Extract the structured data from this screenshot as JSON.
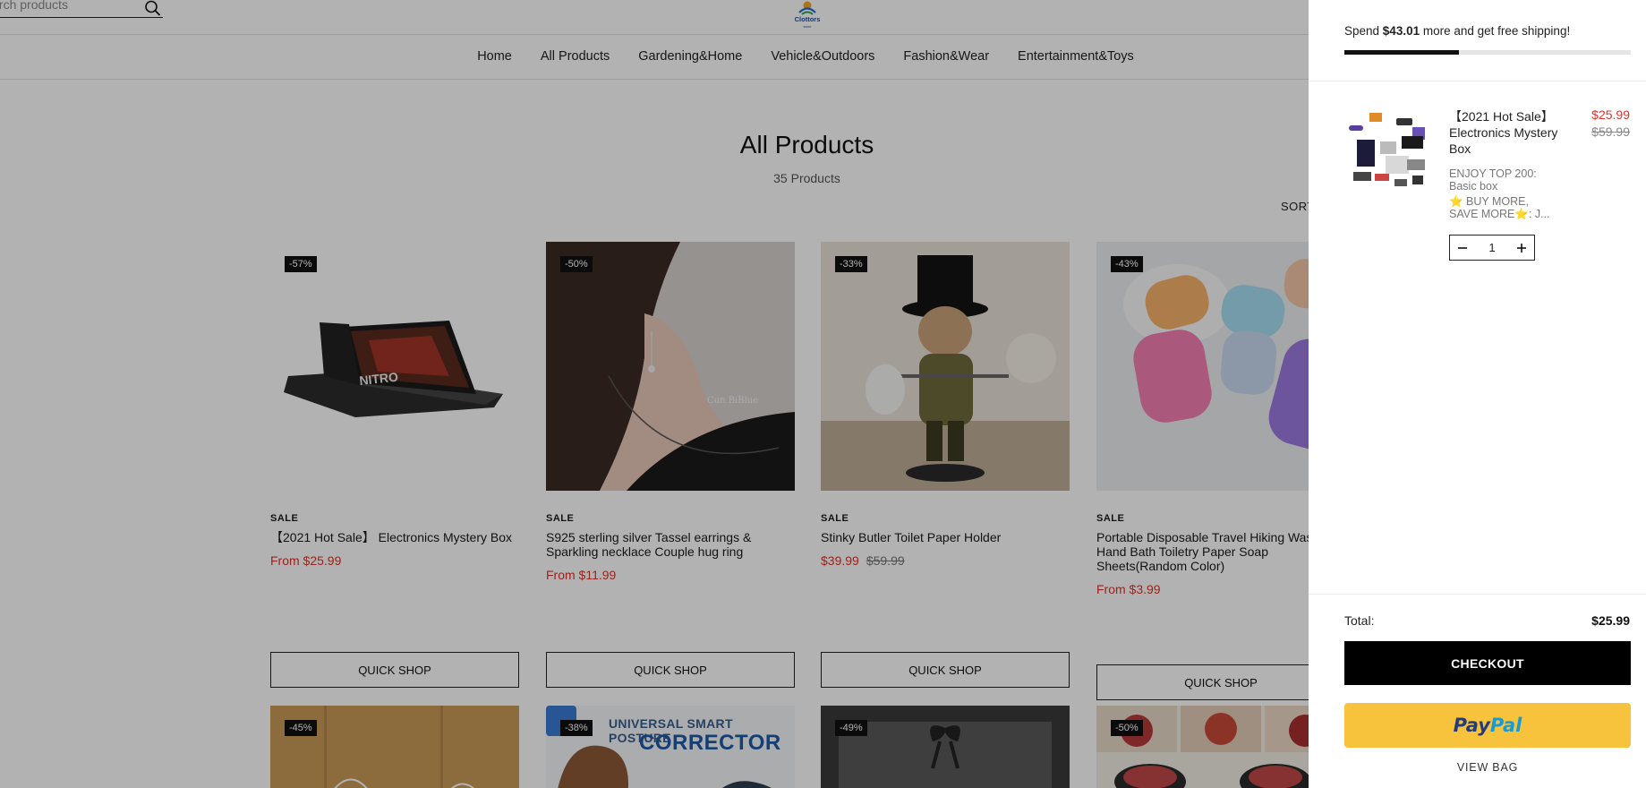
{
  "header": {
    "search_placeholder": "Search products",
    "nav": [
      "Home",
      "All Products",
      "Gardening&Home",
      "Vehicle&Outdoors",
      "Fashion&Wear",
      "Entertainment&Toys"
    ]
  },
  "collection": {
    "title": "All Products",
    "count": "35 Products",
    "sort_label": "SORT"
  },
  "products": [
    {
      "badge": "-57%",
      "label": "SALE",
      "name": "【2021 Hot Sale】 Electronics Mystery Box",
      "price": "From $25.99",
      "old_price": "",
      "button": "QUICK SHOP"
    },
    {
      "badge": "-50%",
      "label": "SALE",
      "name": "S925 sterling silver Tassel earrings & Sparkling necklace Couple hug ring",
      "price": "From $11.99",
      "old_price": "",
      "button": "QUICK SHOP"
    },
    {
      "badge": "-33%",
      "label": "SALE",
      "name": "Stinky Butler Toilet Paper Holder",
      "price": "$39.99",
      "old_price": "$59.99",
      "button": "QUICK SHOP"
    },
    {
      "badge": "-43%",
      "label": "SALE",
      "name": "Portable Disposable Travel Hiking Washing Hand Bath Toiletry Paper Soap Sheets(Random Color)",
      "price": "From $3.99",
      "old_price": "",
      "button": "QUICK SHOP"
    }
  ],
  "products_row2": [
    {
      "badge": "-45%"
    },
    {
      "badge": "-38%",
      "banner_line1": "UNIVERSAL SMART POSTURE",
      "banner_line2": "CORRECTOR"
    },
    {
      "badge": "-49%"
    },
    {
      "badge": "-50%"
    }
  ],
  "cart": {
    "shipping_prefix": "Spend ",
    "shipping_amount": "$43.01",
    "shipping_suffix": " more and get free shipping!",
    "progress": 0.4,
    "item": {
      "name": "【2021 Hot Sale】 Electronics Mystery Box",
      "price": "$25.99",
      "old_price": "$59.99",
      "option1": "ENJOY TOP 200: Basic box",
      "option2": "⭐ BUY MORE, SAVE MORE⭐: J...",
      "quantity": "1"
    },
    "total_label": "Total:",
    "total_value": "$25.99",
    "checkout_label": "CHECKOUT",
    "paypal_part1": "Pay",
    "paypal_part2": "Pal",
    "view_bag_label": "VIEW BAG"
  },
  "colors": {
    "sale_red": "#d9342b",
    "paypal_yellow": "#f8c33c",
    "paypal_dark": "#253b80",
    "paypal_light": "#179bd7"
  }
}
